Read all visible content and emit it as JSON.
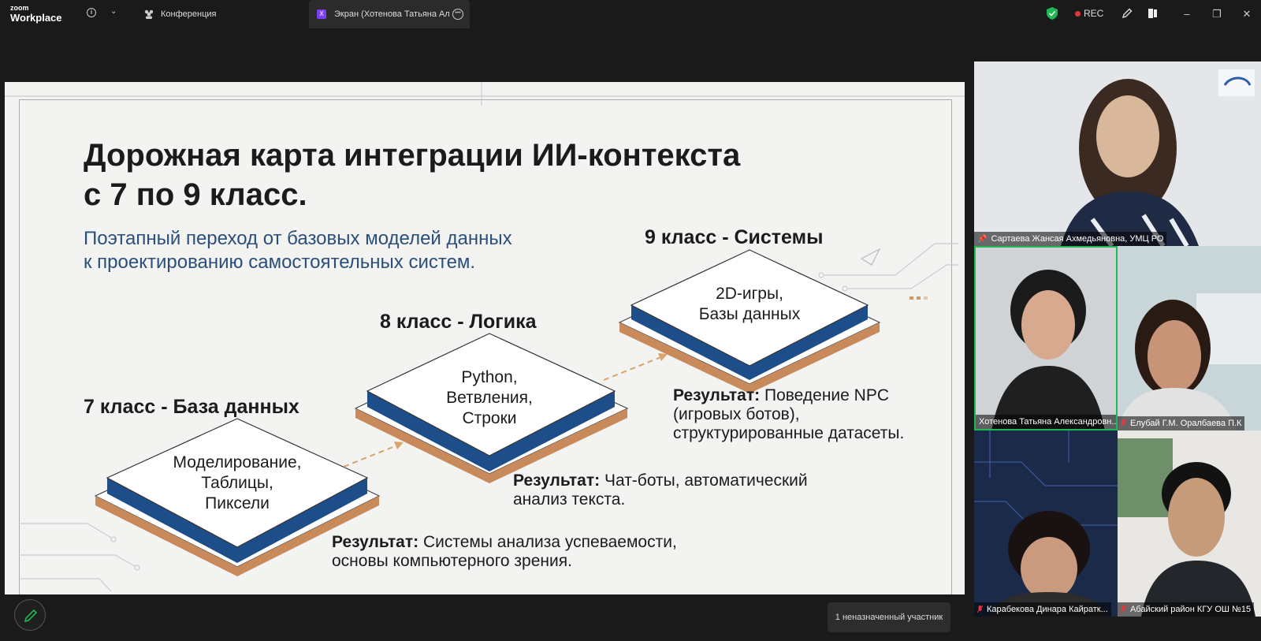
{
  "app": {
    "brand_top": "zoom",
    "brand_bottom": "Workplace"
  },
  "tabs": [
    {
      "label": "Конференция"
    },
    {
      "label": "Экран (Хотенова Татьяна Алекс"
    }
  ],
  "toolbar": {
    "rec_label": "REC",
    "rec_color": "#e0383e",
    "accent": "#7b3ff2",
    "shield_color": "#1fb954"
  },
  "slide": {
    "title_line1": "Дорожная карта интеграции ИИ-контекста",
    "title_line2": "с 7 по 9 класс.",
    "subtitle_line1": "Поэтапный переход от базовых моделей данных",
    "subtitle_line2": "к проектированию самостоятельных систем.",
    "levels": [
      {
        "heading": "7 класс - База данных",
        "plate": [
          "Моделирование,",
          "Таблицы,",
          "Пиксели"
        ],
        "result_label": "Результат:",
        "result_line1": " Системы анализа успеваемости,",
        "result_line2": "основы компьютерного зрения."
      },
      {
        "heading": "8 класс - Логика",
        "plate": [
          "Python,",
          "Ветвления,",
          "Строки"
        ],
        "result_label": "Результат:",
        "result_line1": " Чат-боты, автоматический",
        "result_line2": "анализ текста."
      },
      {
        "heading": "9 класс - Системы",
        "plate": [
          "2D-игры,",
          "Базы  данных"
        ],
        "result_label": "Результат:",
        "result_line1": " Поведение NPC",
        "result_line2": "(игровых ботов),",
        "result_line3": "структурированные датасеты."
      }
    ],
    "colors": {
      "plate_blue": "#1d4e89",
      "plate_copper": "#c98a5b",
      "arrow": "#d9a36b"
    }
  },
  "participants": [
    {
      "name": "Сартаева Жансая Ахмедьяновна, УМЦ РО",
      "pinned": true
    },
    {
      "name": "Хотенова Татьяна Александровн...",
      "speaking": true
    },
    {
      "name": "Елубай Г.М. Оралбаева П.К",
      "muted": true
    },
    {
      "name": "Карабекова Динара Кайратк...",
      "muted": true
    },
    {
      "name": "Абайский район КГУ ОШ №15",
      "muted": true
    }
  ],
  "tooltip": "1 неназначенный участник"
}
